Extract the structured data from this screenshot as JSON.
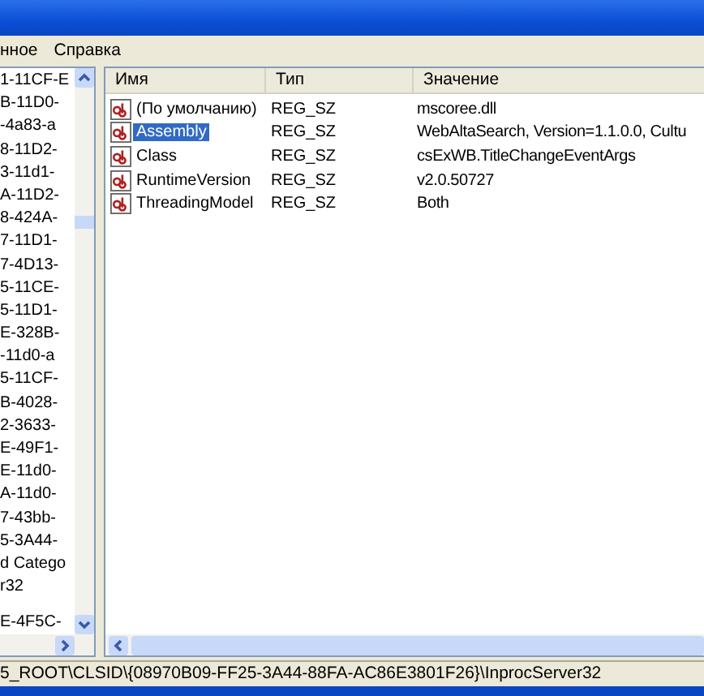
{
  "menu": [
    "нное",
    "Справка"
  ],
  "tree": {
    "items": [
      {
        "label": "1-11CF-E"
      },
      {
        "label": "B-11D0-"
      },
      {
        "label": "-4a83-a"
      },
      {
        "label": "8-11D2-"
      },
      {
        "label": "3-11d1-"
      },
      {
        "label": "A-11D2-"
      },
      {
        "label": "8-424A-"
      },
      {
        "label": "7-11D1-"
      },
      {
        "label": "7-4D13-"
      },
      {
        "label": "5-11CE-"
      },
      {
        "label": "5-11D1-"
      },
      {
        "label": "E-328B-"
      },
      {
        "label": "-11d0-a"
      },
      {
        "label": "5-11CF-"
      },
      {
        "label": "B-4028-"
      },
      {
        "label": "2-3633-"
      },
      {
        "label": "E-49F1-"
      },
      {
        "label": "E-11d0-"
      },
      {
        "label": "A-11d0-"
      },
      {
        "label": "7-43bb-"
      },
      {
        "label": "5-3A44-"
      },
      {
        "label": "d Catego"
      },
      {
        "label": "r32"
      },
      {
        "label": "E-4F5C-"
      }
    ]
  },
  "list": {
    "columns": [
      "Имя",
      "Тип",
      "Значение"
    ],
    "rows": [
      {
        "name": "(По умолчанию)",
        "type": "REG_SZ",
        "value": "mscoree.dll",
        "selected": false
      },
      {
        "name": "Assembly",
        "type": "REG_SZ",
        "value": "WebAltaSearch, Version=1.1.0.0, Cultu",
        "selected": true
      },
      {
        "name": "Class",
        "type": "REG_SZ",
        "value": "csExWB.TitleChangeEventArgs",
        "selected": false
      },
      {
        "name": "RuntimeVersion",
        "type": "REG_SZ",
        "value": "v2.0.50727",
        "selected": false
      },
      {
        "name": "ThreadingModel",
        "type": "REG_SZ",
        "value": "Both",
        "selected": false
      }
    ]
  },
  "status_bar": "5_ROOT\\CLSID\\{08970B09-FF25-3A44-88FA-AC86E3801F26}\\InprocServer32"
}
